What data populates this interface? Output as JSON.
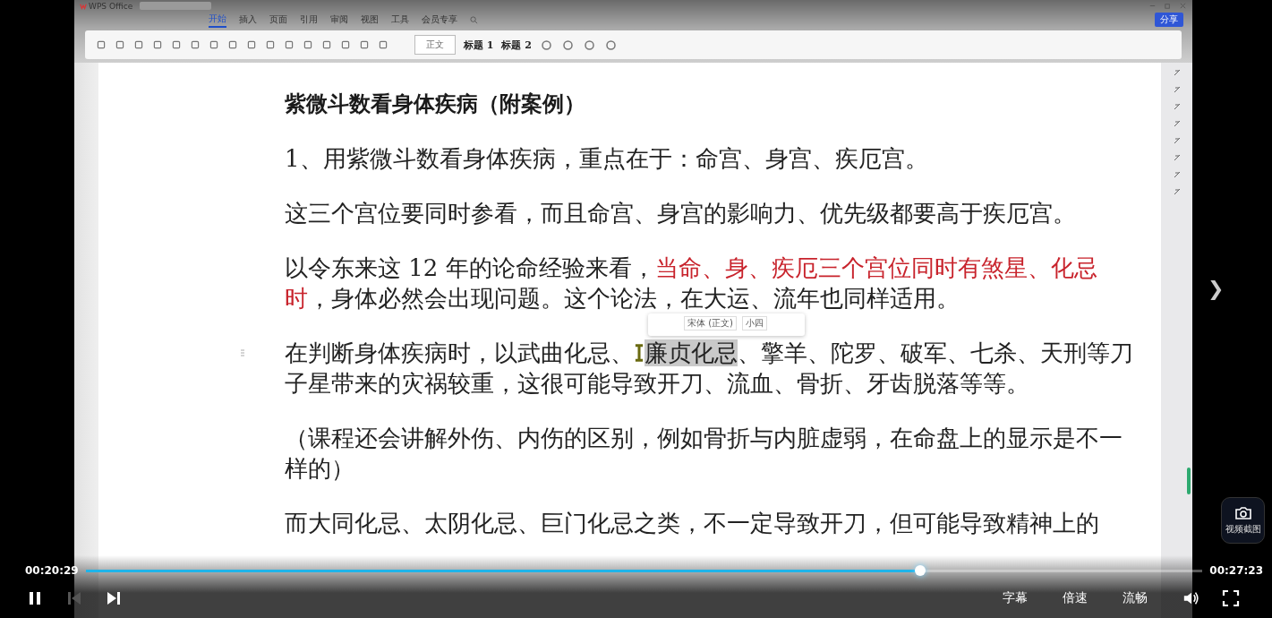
{
  "wps": {
    "app_tab": "WPS Office",
    "menu_tabs": [
      {
        "label": "开始",
        "selected": true
      },
      {
        "label": "插入",
        "selected": false
      },
      {
        "label": "页面",
        "selected": false
      },
      {
        "label": "引用",
        "selected": false
      },
      {
        "label": "审阅",
        "selected": false
      },
      {
        "label": "视图",
        "selected": false
      },
      {
        "label": "工具",
        "selected": false
      },
      {
        "label": "会员专享",
        "selected": false
      }
    ],
    "styles": [
      {
        "label": "正文",
        "selected": true
      },
      {
        "label": "标题 1",
        "selected": false
      },
      {
        "label": "标题 2",
        "selected": false
      }
    ],
    "share_button": "分享"
  },
  "document": {
    "title": "紫微斗数看身体疾病（附案例）",
    "paragraphs": [
      {
        "segments": [
          {
            "kind": "plain",
            "text": "1、用紫微斗数看身体疾病，重点在于：命宫、身宫、疾厄宫。"
          }
        ]
      },
      {
        "segments": [
          {
            "kind": "plain",
            "text": "这三个宫位要同时参看，而且命宫、身宫的影响力、优先级都要高于疾厄宫。"
          }
        ]
      },
      {
        "segments": [
          {
            "kind": "plain",
            "text": "以令东来这 12 年的论命经验来看，"
          },
          {
            "kind": "emphasis",
            "text": "当命、身、疾厄三个宫位同时有煞星、化忌时"
          },
          {
            "kind": "plain",
            "text": "，身体必然会出现问题。这个论法，在大运、流年也同样适用。"
          }
        ]
      },
      {
        "segments": [
          {
            "kind": "plain",
            "text": "在判断身体疾病时，以武曲化忌、"
          },
          {
            "kind": "cursor"
          },
          {
            "kind": "selected",
            "text": "廉贞化忌"
          },
          {
            "kind": "plain",
            "text": "、擎羊、陀罗、破军、七杀、天刑等刀子星带来的灾祸较重，这很可能导致开刀、流血、骨折、牙齿脱落等等。"
          }
        ],
        "mini_toolbar": {
          "font": "宋体 (正文)",
          "size": "小四"
        }
      },
      {
        "segments": [
          {
            "kind": "plain",
            "text": "（课程还会讲解外伤、内伤的区别，例如骨折与内脏虚弱，在命盘上的显示是不一样的）"
          }
        ]
      },
      {
        "segments": [
          {
            "kind": "plain",
            "text": "而大同化忌、太阴化忌、巨门化忌之类，不一定导致开刀，但可能导致精神上的"
          }
        ]
      }
    ]
  },
  "player": {
    "elapsed": "00:20:29",
    "total": "00:27:23",
    "progress": {
      "level": 0.747
    },
    "playing": true,
    "prev_disabled": true,
    "options": [
      "字幕",
      "倍速",
      "流畅"
    ]
  },
  "next_arrow": "❯",
  "screenshot_button": "视频截图"
}
